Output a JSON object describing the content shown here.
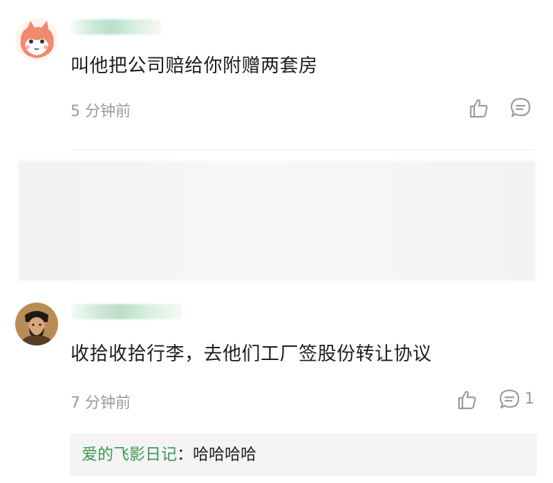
{
  "comments": [
    {
      "text": "叫他把公司赔给你附赠两套房",
      "time": "5 分钟前",
      "avatar": "cartoon-fox-avatar"
    },
    {
      "text": "收拾收拾行李，去他们工厂签股份转让协议",
      "time": "7 分钟前",
      "avatar": "scholar-portrait-avatar",
      "reply_count": "1",
      "reply": {
        "author": "爱的飞影日记",
        "separator": "：",
        "text": "哈哈哈哈"
      }
    }
  ],
  "colors": {
    "reply_author": "#3a9a55",
    "time_text": "#9a9a9a",
    "reply_background": "#f4f4f4"
  }
}
